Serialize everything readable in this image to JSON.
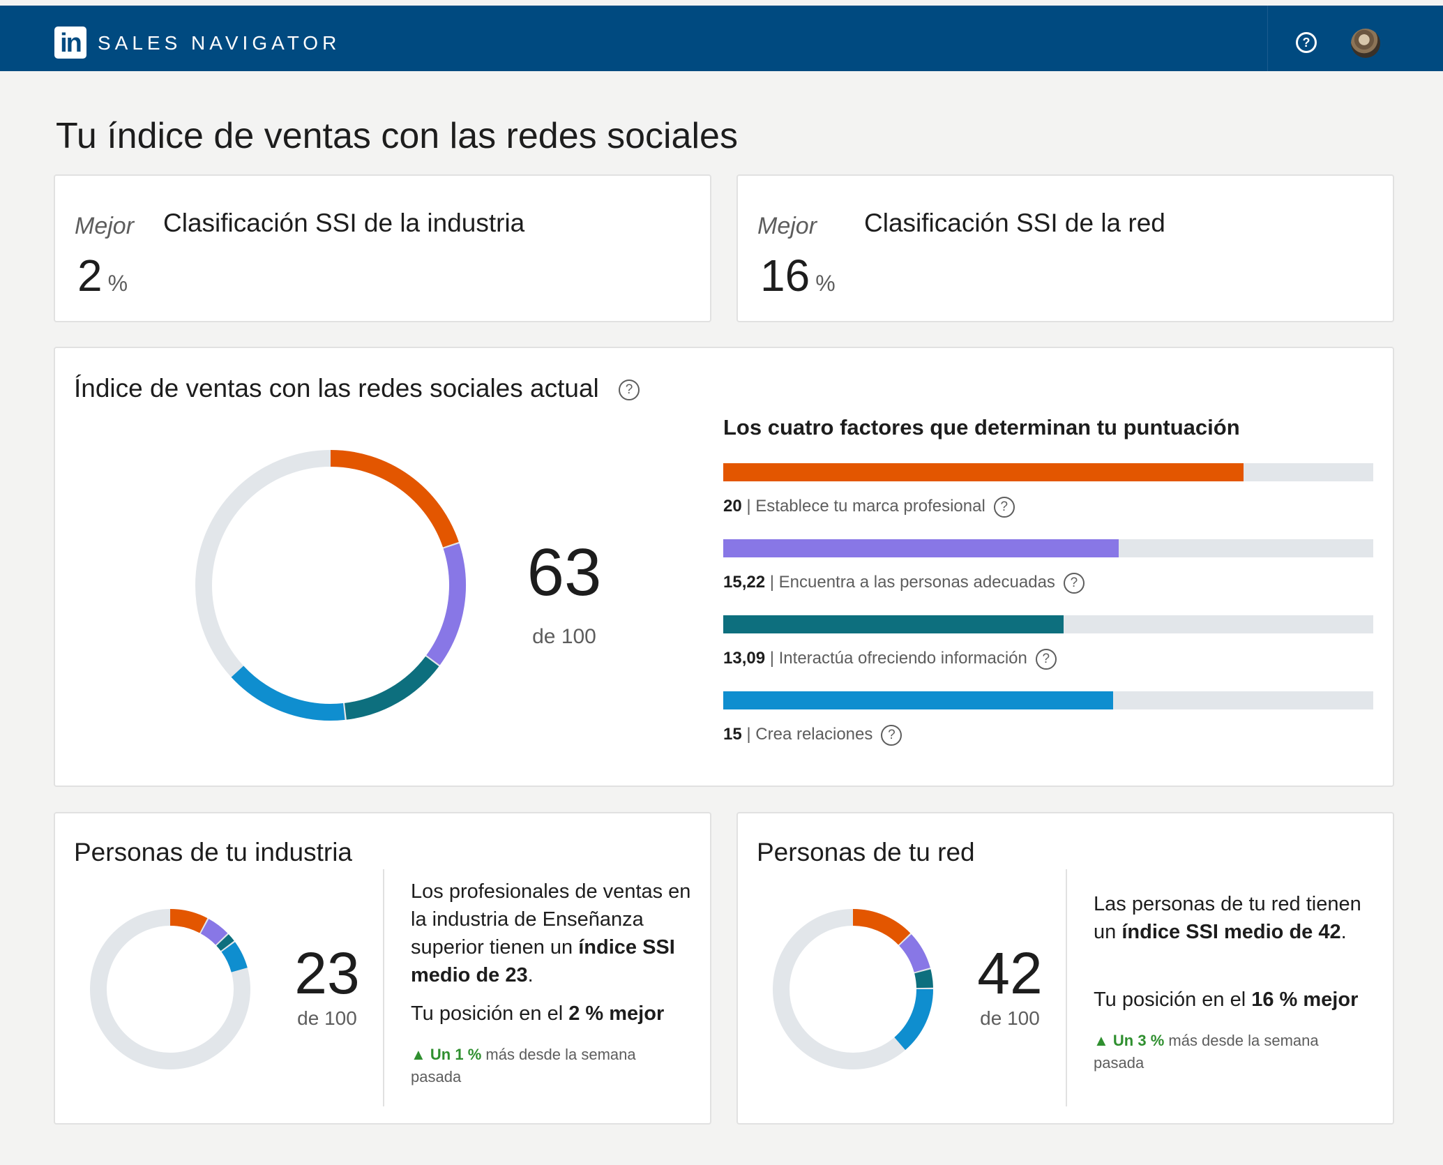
{
  "header": {
    "logo_text": "in",
    "brand": "SALES NAVIGATOR",
    "help_icon": "help-circle-icon",
    "avatar": "user-avatar"
  },
  "page": {
    "title": "Tu índice de ventas con las redes sociales"
  },
  "industry_rank": {
    "qualifier": "Mejor",
    "title": "Clasificación SSI de la industria",
    "value": "2",
    "unit": "%"
  },
  "network_rank": {
    "qualifier": "Mejor",
    "title": "Clasificación SSI de la red",
    "value": "16",
    "unit": "%"
  },
  "current_ssi": {
    "title": "Índice de ventas con las redes sociales actual",
    "score": "63",
    "score_of": "de 100",
    "factors_title": "Los cuatro factores que determinan tu puntuación",
    "factors": [
      {
        "value": "20",
        "label": "Establece tu marca profesional",
        "score": 20,
        "max": 25,
        "color": "#e35600"
      },
      {
        "value": "15,22",
        "label": "Encuentra a las personas adecuadas",
        "score": 15.22,
        "max": 25,
        "color": "#8877e6"
      },
      {
        "value": "13,09",
        "label": "Interactúa ofreciendo información",
        "score": 13.09,
        "max": 25,
        "color": "#0d6f7e"
      },
      {
        "value": "15",
        "label": "Crea relaciones",
        "score": 15,
        "max": 25,
        "color": "#0f8ecf"
      }
    ],
    "separator": "|"
  },
  "industry_people": {
    "title": "Personas de tu industria",
    "score": "23",
    "score_of": "de 100",
    "segments": [
      {
        "value": 8,
        "color": "#e35600"
      },
      {
        "value": 5,
        "color": "#8877e6"
      },
      {
        "value": 2,
        "color": "#0d6f7e"
      },
      {
        "value": 6,
        "color": "#0f8ecf"
      }
    ],
    "text_pre": "Los profesionales de ventas en la industria de Enseñanza superior tienen un ",
    "text_bold": "índice SSI medio de 23",
    "text_post": ".",
    "position_pre": "Tu posición en el ",
    "position_bold": "2 % mejor",
    "delta_arrow": "▲",
    "delta_bold": "Un 1 %",
    "delta_rest": " más desde la semana pasada"
  },
  "network_people": {
    "title": "Personas de tu red",
    "score": "42",
    "score_of": "de 100",
    "segments": [
      {
        "value": 13,
        "color": "#e35600"
      },
      {
        "value": 8,
        "color": "#8877e6"
      },
      {
        "value": 4,
        "color": "#0d6f7e"
      },
      {
        "value": 14,
        "color": "#0f8ecf"
      }
    ],
    "text_pre": "Las personas de tu red tienen un ",
    "text_bold": "índice SSI medio de 42",
    "text_post": ".",
    "position_pre": "Tu posición en el ",
    "position_bold": "16 % mejor",
    "delta_arrow": "▲",
    "delta_bold": "Un 3 %",
    "delta_rest": " más desde la semana pasada"
  },
  "icons": {
    "help": "?"
  }
}
